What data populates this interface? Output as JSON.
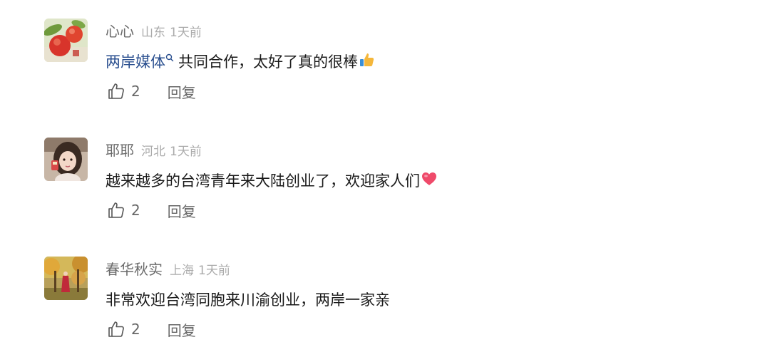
{
  "comments": [
    {
      "user": "心心",
      "location": "山东",
      "time": "1天前",
      "link_text": "两岸媒体",
      "text": "共同合作，太好了真的很棒",
      "emoji": "thumbs-up",
      "likes": "2",
      "reply_label": "回复"
    },
    {
      "user": "耶耶",
      "location": "河北",
      "time": "1天前",
      "text": "越来越多的台湾青年来大陆创业了，欢迎家人们",
      "emoji": "heart",
      "likes": "2",
      "reply_label": "回复"
    },
    {
      "user": "春华秋实",
      "location": "上海",
      "time": "1天前",
      "text": "非常欢迎台湾同胞来川渝创业，两岸一家亲",
      "likes": "2",
      "reply_label": "回复"
    }
  ],
  "colors": {
    "name": "#6a6a6a",
    "meta": "#ababab",
    "body": "#1a1a1a",
    "link": "#2a4f8f",
    "action": "#666666"
  }
}
